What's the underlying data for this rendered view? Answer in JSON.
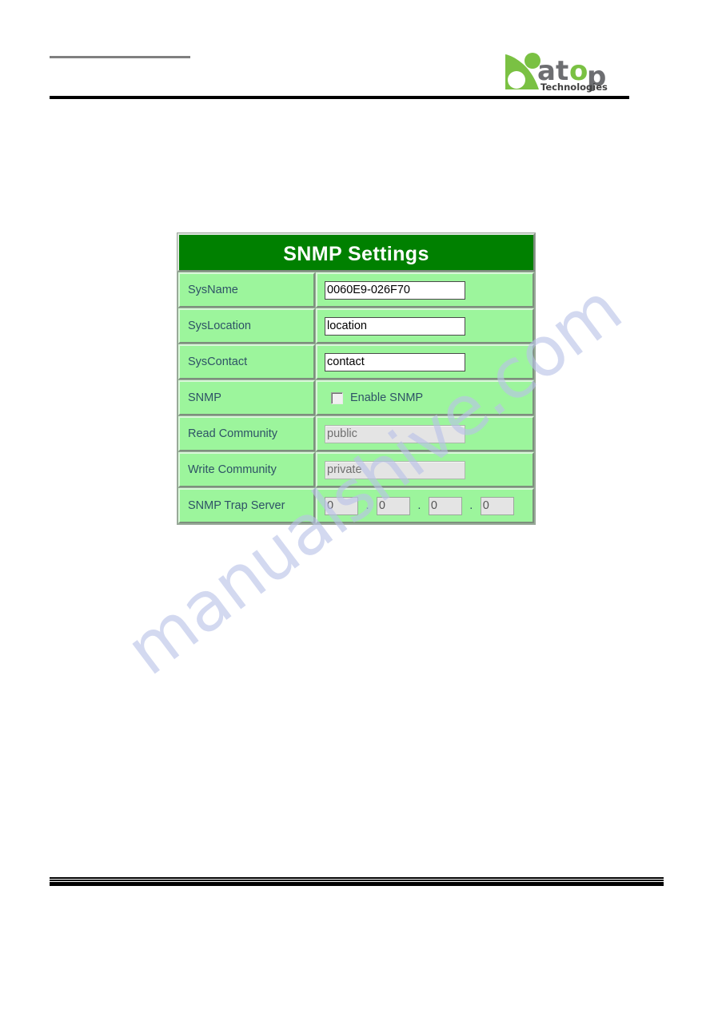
{
  "page": {
    "brand": {
      "name_part_1": "at",
      "name_part_2": "o",
      "name_part_3": "p",
      "tagline": "Technologies",
      "mark_color": "#7ac143",
      "text_color": "#6d6e71"
    },
    "rules": {
      "header_accent_color": "#808080",
      "header_rule_color": "#000000",
      "footer_rule_color": "#000000"
    },
    "watermark": {
      "text": "manualshive.com",
      "color": "#b9c2e8"
    }
  },
  "panel": {
    "title": "SNMP Settings",
    "title_bg": "#008000",
    "cell_bg": "#9cf59c",
    "label_color": "#2e5266",
    "rows": [
      {
        "label": "SysName",
        "type": "text",
        "value": "0060E9-026F70",
        "disabled": false
      },
      {
        "label": "SysLocation",
        "type": "text",
        "value": "location",
        "disabled": false
      },
      {
        "label": "SysContact",
        "type": "text",
        "value": "contact",
        "disabled": false
      },
      {
        "label": "SNMP",
        "type": "checkbox",
        "checkbox_label": "Enable SNMP",
        "checked": false
      },
      {
        "label": "Read Community",
        "type": "text",
        "value": "public",
        "disabled": true
      },
      {
        "label": "Write Community",
        "type": "text",
        "value": "private",
        "disabled": true
      },
      {
        "label": "SNMP Trap Server",
        "type": "ip",
        "octets": [
          "0",
          "0",
          "0",
          "0"
        ],
        "separator": "."
      }
    ]
  }
}
